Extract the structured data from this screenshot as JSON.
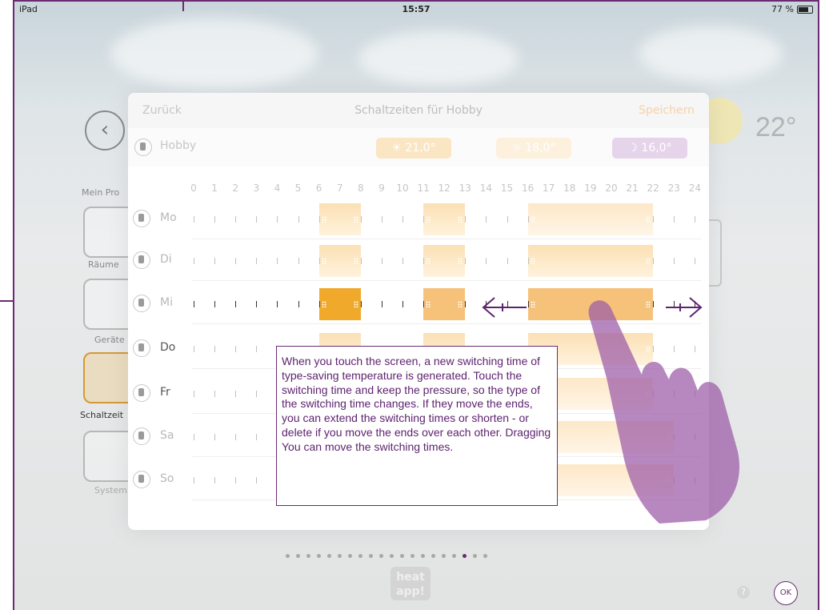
{
  "status_bar": {
    "device": "iPad",
    "time": "15:57",
    "battery": "77 %"
  },
  "backdrop": {
    "current_temp": "22°",
    "side_labels": [
      "Mein Pro",
      "Räume",
      "Geräte",
      "Schaltzeit",
      "System"
    ]
  },
  "modal": {
    "back_label": "Zurück",
    "title": "Schaltzeiten für Hobby",
    "save_label": "Speichern",
    "room_name": "Hobby",
    "temps": {
      "comfort": "21,0°",
      "eco": "18,0°",
      "night": "16,0°"
    },
    "hours": [
      "0",
      "1",
      "2",
      "3",
      "4",
      "5",
      "6",
      "7",
      "8",
      "9",
      "10",
      "11",
      "12",
      "13",
      "14",
      "15",
      "16",
      "17",
      "18",
      "19",
      "20",
      "21",
      "22",
      "23",
      "24"
    ],
    "days": [
      "Mo",
      "Di",
      "Mi",
      "Do",
      "Fr",
      "Sa",
      "So"
    ]
  },
  "tooltip": "When you touch the screen, a new switching time of type-saving temperature is generated. Touch the switching time and keep the pressure, so the type of the switching time changes. If they move the ends, you can extend the switching times or shorten - or delete if you move the ends over each other. Dragging You can move the switching times.",
  "pager": {
    "count": 20,
    "active_index": 17
  },
  "logo_text": "heat app!",
  "ok_label": "OK",
  "colors": {
    "accent": "#6b2a72",
    "comfort": "#f0a92a",
    "eco": "#fde8c8",
    "night": "#c8a6d4"
  }
}
